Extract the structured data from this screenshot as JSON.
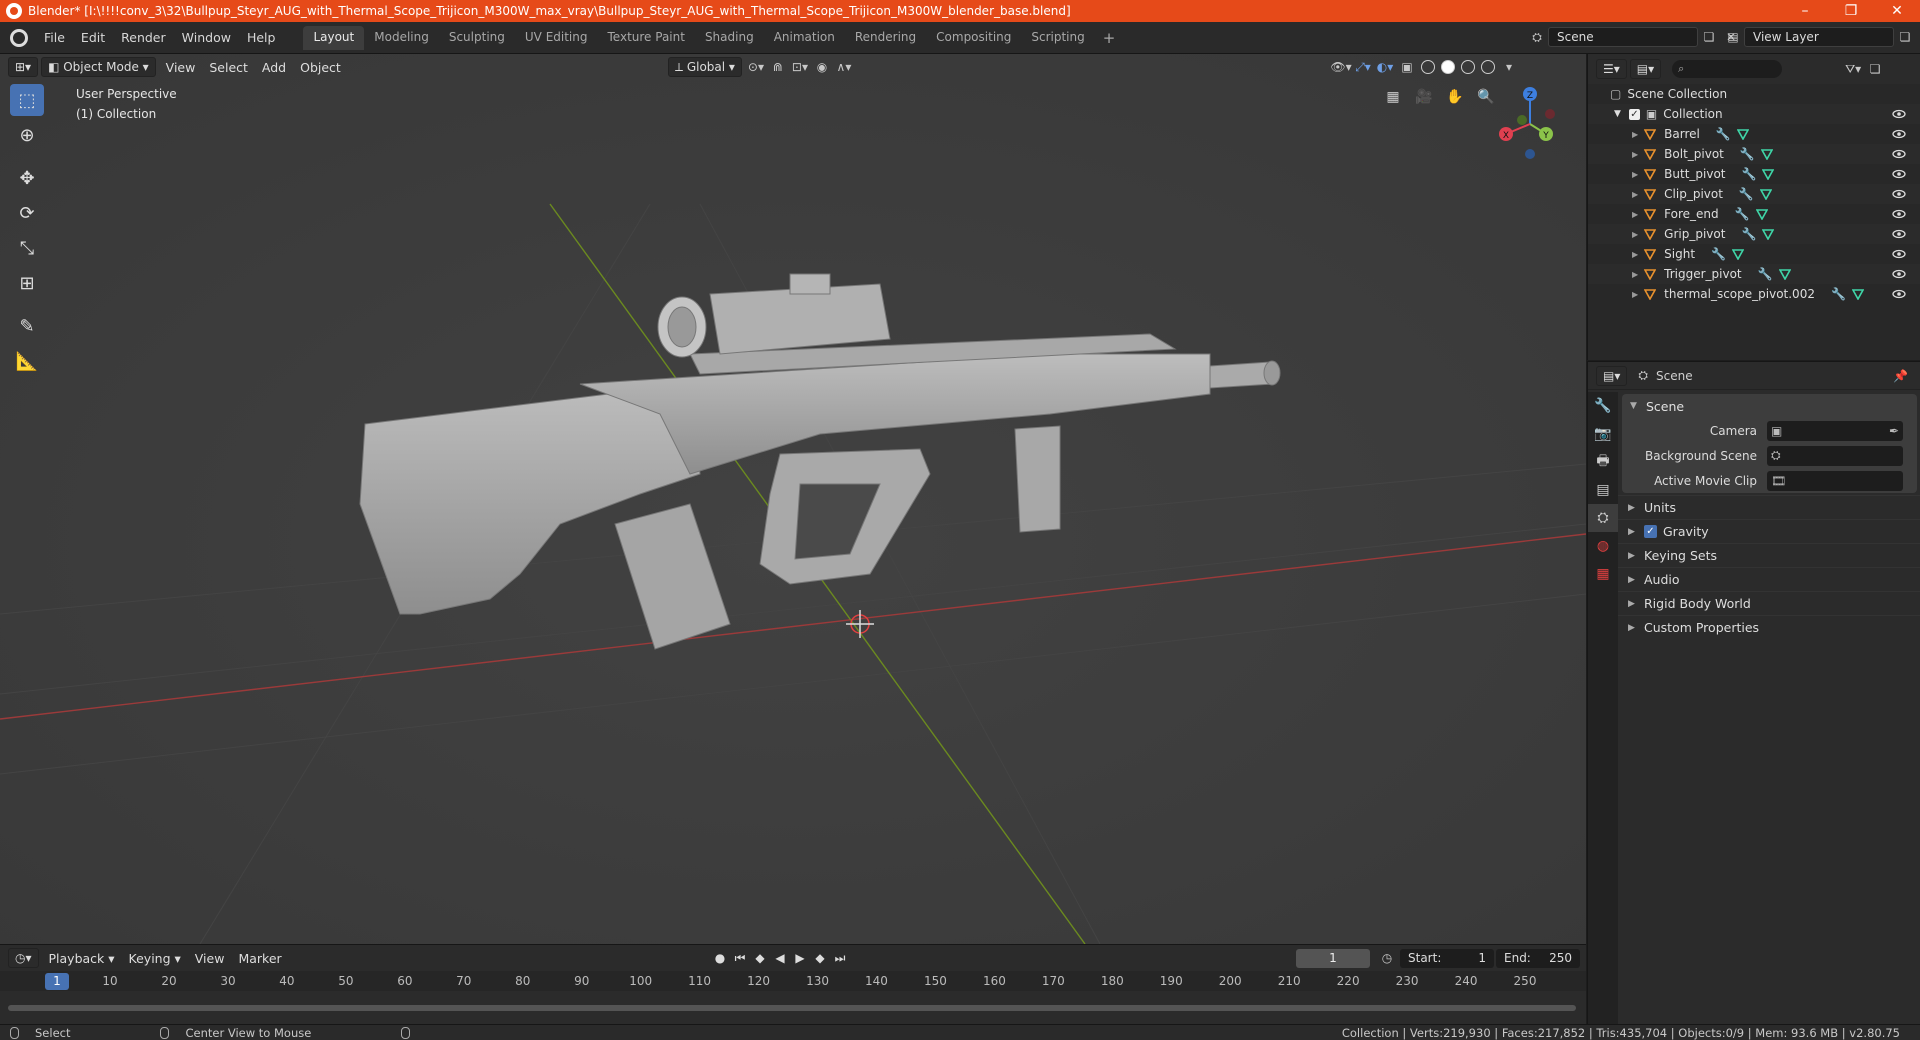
{
  "window": {
    "title": "Blender* [I:\\!!!!conv_3\\32\\Bullpup_Steyr_AUG_with_Thermal_Scope_Trijicon_M300W_max_vray\\Bullpup_Steyr_AUG_with_Thermal_Scope_Trijicon_M300W_blender_base.blend]",
    "minimize": "–",
    "maximize": "❐",
    "close": "✕"
  },
  "menu": [
    "File",
    "Edit",
    "Render",
    "Window",
    "Help"
  ],
  "workspaces": [
    "Layout",
    "Modeling",
    "Sculpting",
    "UV Editing",
    "Texture Paint",
    "Shading",
    "Animation",
    "Rendering",
    "Compositing",
    "Scripting"
  ],
  "workspace_add": "+",
  "scene": {
    "name": "Scene",
    "view_layer": "View Layer"
  },
  "viewport": {
    "mode": "Object Mode",
    "menus": [
      "View",
      "Select",
      "Add",
      "Object"
    ],
    "transform_orientation": "Global",
    "info_line1": "User Perspective",
    "info_line2": "(1) Collection",
    "gizmo_labels": {
      "z": "Z",
      "y": "Y",
      "x": "X"
    }
  },
  "outliner": {
    "root": "Scene Collection",
    "collection": "Collection",
    "objects": [
      "Barrel",
      "Bolt_pivot",
      "Butt_pivot",
      "Clip_pivot",
      "Fore_end",
      "Grip_pivot",
      "Sight",
      "Trigger_pivot",
      "thermal_scope_pivot.002"
    ]
  },
  "properties": {
    "header": "Scene",
    "section": "Scene",
    "fields": [
      {
        "label": "Camera"
      },
      {
        "label": "Background Scene"
      },
      {
        "label": "Active Movie Clip"
      }
    ],
    "subpanels": [
      "Units",
      "Gravity",
      "Keying Sets",
      "Audio",
      "Rigid Body World",
      "Custom Properties"
    ]
  },
  "timeline": {
    "menus": [
      "Playback",
      "Keying",
      "View",
      "Marker"
    ],
    "current_frame": "1",
    "start_label": "Start:",
    "start": "1",
    "end_label": "End:",
    "end": "250",
    "ruler": [
      "1",
      "10",
      "20",
      "30",
      "40",
      "50",
      "60",
      "70",
      "80",
      "90",
      "100",
      "110",
      "120",
      "130",
      "140",
      "150",
      "160",
      "170",
      "180",
      "190",
      "200",
      "210",
      "220",
      "230",
      "240",
      "250"
    ]
  },
  "status": {
    "left1": "Select",
    "left2": "Center View to Mouse",
    "right": "Collection | Verts:219,930 | Faces:217,852 | Tris:435,704 | Objects:0/9 | Mem: 93.6 MB | v2.80.75"
  },
  "colors": {
    "accent": "#4772b3",
    "titlebar": "#e64a19",
    "object_icon": "#e8912d",
    "mesh_icon": "#3fd6a8",
    "modifier_icon": "#6e9fe6"
  }
}
